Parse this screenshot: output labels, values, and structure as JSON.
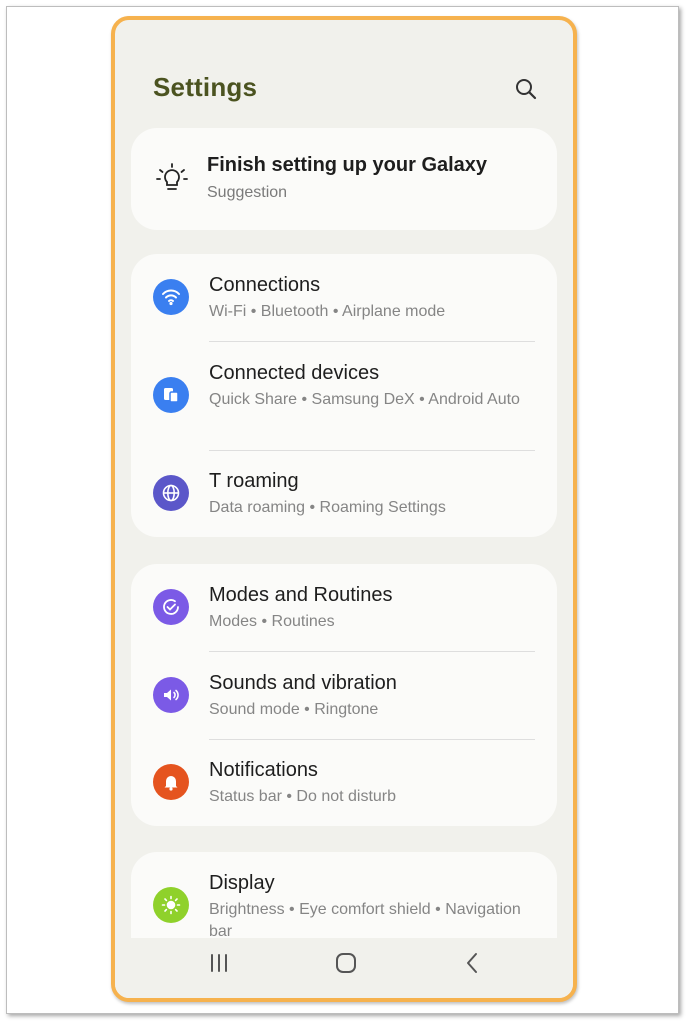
{
  "header": {
    "title": "Settings"
  },
  "suggestion": {
    "title": "Finish setting up your Galaxy",
    "subtitle": "Suggestion"
  },
  "groups": [
    {
      "items": [
        {
          "title": "Connections",
          "subtitle": "Wi-Fi  •  Bluetooth  •  Airplane mode",
          "icon": "wifi-icon",
          "color": "#3a7ff0"
        },
        {
          "title": "Connected devices",
          "subtitle": "Quick Share  •  Samsung DeX  •  Android Auto",
          "icon": "devices-icon",
          "color": "#3a7ff0"
        },
        {
          "title": "T roaming",
          "subtitle": "Data roaming  •  Roaming Settings",
          "icon": "globe-icon",
          "color": "#5b57c9"
        }
      ]
    },
    {
      "items": [
        {
          "title": "Modes and Routines",
          "subtitle": "Modes  •  Routines",
          "icon": "routines-icon",
          "color": "#7b5ae6"
        },
        {
          "title": "Sounds and vibration",
          "subtitle": "Sound mode  •  Ringtone",
          "icon": "speaker-icon",
          "color": "#7b5ae6"
        },
        {
          "title": "Notifications",
          "subtitle": "Status bar  •  Do not disturb",
          "icon": "bell-icon",
          "color": "#e5541f"
        }
      ]
    },
    {
      "items": [
        {
          "title": "Display",
          "subtitle": "Brightness  •  Eye comfort shield  •  Navigation bar",
          "icon": "brightness-icon",
          "color": "#8fd12b"
        }
      ]
    }
  ],
  "navbar": {
    "recents": "recent-apps-icon",
    "home": "home-icon",
    "back": "back-icon"
  }
}
